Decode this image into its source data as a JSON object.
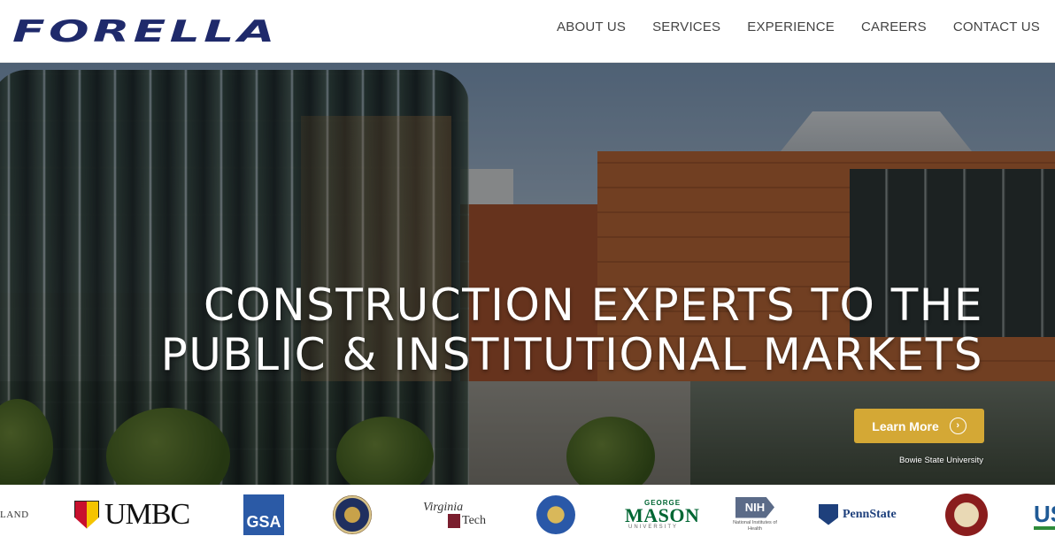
{
  "header": {
    "logo_text": "FORELLA",
    "nav": [
      {
        "label": "ABOUT US"
      },
      {
        "label": "SERVICES"
      },
      {
        "label": "EXPERIENCE"
      },
      {
        "label": "CAREERS"
      },
      {
        "label": "CONTACT US"
      }
    ]
  },
  "hero": {
    "headline_line1": "CONSTRUCTION EXPERTS TO THE",
    "headline_line2": "PUBLIC & INSTITUTIONAL MARKETS",
    "cta_label": "Learn More",
    "cta_icon": "chevron-right-circle-icon",
    "caption": "Bowie State University"
  },
  "clients": {
    "land_text": "LAND",
    "umbc_text": "UMBC",
    "gsa_text": "GSA",
    "vt_top": "Virginia",
    "vt_bottom": "Tech",
    "mason_top": "GEORGE",
    "mason_main": "MASON",
    "mason_sub": "UNIVERSITY",
    "nih_text": "NIH",
    "nih_sub": "National Institutes of Health",
    "psu_text": "PennState",
    "us_text": "US"
  },
  "colors": {
    "brand_navy": "#1f2a6b",
    "cta_gold": "#d4a835"
  }
}
